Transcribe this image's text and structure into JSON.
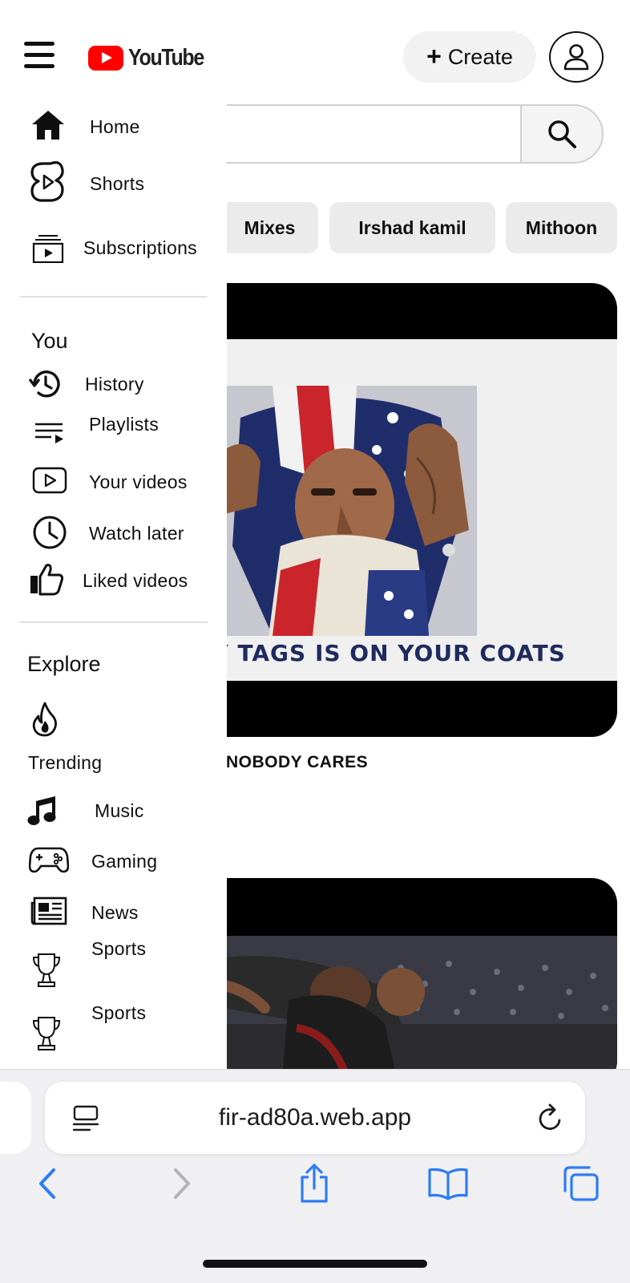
{
  "header": {
    "logo_text": "YouTube",
    "create_label": "Create"
  },
  "search": {
    "placeholder": ""
  },
  "chips": [
    "Mixes",
    "Irshad kamil",
    "Mithoon"
  ],
  "videos": [
    {
      "thumbnail_caption": "NY TAGS IS ON YOUR COATS",
      "title": "NOBODY CARES"
    },
    {
      "thumbnail_caption": "",
      "title": ""
    }
  ],
  "drawer": {
    "main": [
      {
        "label": "Home",
        "icon": "home-icon"
      },
      {
        "label": "Shorts",
        "icon": "shorts-icon"
      },
      {
        "label": "Subscriptions",
        "icon": "subscriptions-icon"
      }
    ],
    "you_title": "You",
    "you": [
      {
        "label": "History",
        "icon": "history-icon"
      },
      {
        "label": "Playlists",
        "icon": "playlists-icon"
      },
      {
        "label": "Your videos",
        "icon": "your-videos-icon"
      },
      {
        "label": "Watch later",
        "icon": "watch-later-icon"
      },
      {
        "label": "Liked videos",
        "icon": "liked-videos-icon"
      }
    ],
    "explore_title": "Explore",
    "explore": [
      {
        "label": "Trending",
        "icon": "trending-icon"
      },
      {
        "label": "Music",
        "icon": "music-icon"
      },
      {
        "label": "Gaming",
        "icon": "gaming-icon"
      },
      {
        "label": "News",
        "icon": "news-icon"
      },
      {
        "label": "Sports",
        "icon": "trophy-icon"
      },
      {
        "label": "Sports",
        "icon": "trophy-icon"
      }
    ]
  },
  "browser": {
    "url": "fir-ad80a.web.app",
    "accent_color": "#2d7cf6"
  }
}
